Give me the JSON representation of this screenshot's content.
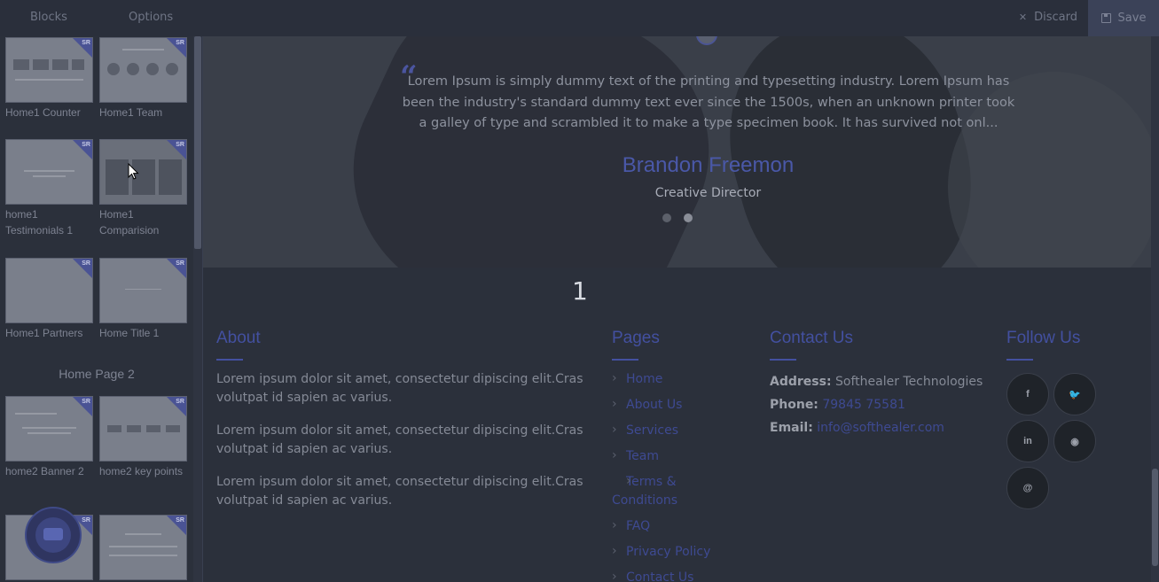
{
  "topbar": {
    "tabs": [
      "Blocks",
      "Options"
    ],
    "discard_label": "Discard",
    "save_label": "Save"
  },
  "panel": {
    "blocks": [
      {
        "label": "Home1 Counter"
      },
      {
        "label": "Home1 Team"
      },
      {
        "label": "home1 Testimonials 1"
      },
      {
        "label": "Home1 Comparision"
      },
      {
        "label": "Home1 Partners"
      },
      {
        "label": "Home Title 1"
      },
      {
        "label": "home2 Banner 2"
      },
      {
        "label": "home2 key points"
      },
      {
        "label": ""
      },
      {
        "label": ""
      }
    ],
    "section_title": "Home Page 2",
    "badge": "SR"
  },
  "hero": {
    "quote_mark": "“",
    "quote": "Lorem Ipsum is simply dummy text of the printing and typesetting industry. Lorem Ipsum has been the industry's standard dummy text ever since the 1500s, when an unknown printer took a galley of type and scrambled it to make a type specimen book. It has survived not onl...",
    "name": "Brandon Freemon",
    "role": "Creative Director"
  },
  "page_number": "1",
  "footer": {
    "about": {
      "title": "About",
      "paragraphs": [
        "Lorem ipsum dolor sit amet, consectetur dipiscing elit.Cras volutpat id sapien ac varius.",
        "Lorem ipsum dolor sit amet, consectetur dipiscing elit.Cras volutpat id sapien ac varius.",
        "Lorem ipsum dolor sit amet, consectetur dipiscing elit.Cras volutpat id sapien ac varius."
      ]
    },
    "pages": {
      "title": "Pages",
      "links": [
        "Home",
        "About Us",
        "Services",
        "Team",
        "Terms & Conditions",
        "FAQ",
        "Privacy Policy",
        "Contact Us"
      ]
    },
    "contact": {
      "title": "Contact Us",
      "address_label": "Address:",
      "address": "Softhealer Technologies",
      "phone_label": "Phone:",
      "phone": "79845 75581",
      "email_label": "Email:",
      "email": "info@softhealer.com"
    },
    "follow": {
      "title": "Follow Us",
      "icons": [
        "f",
        "t",
        "in",
        "gh",
        "@"
      ]
    }
  },
  "colors": {
    "accent": "#4350a0",
    "background": "#2b303b"
  }
}
